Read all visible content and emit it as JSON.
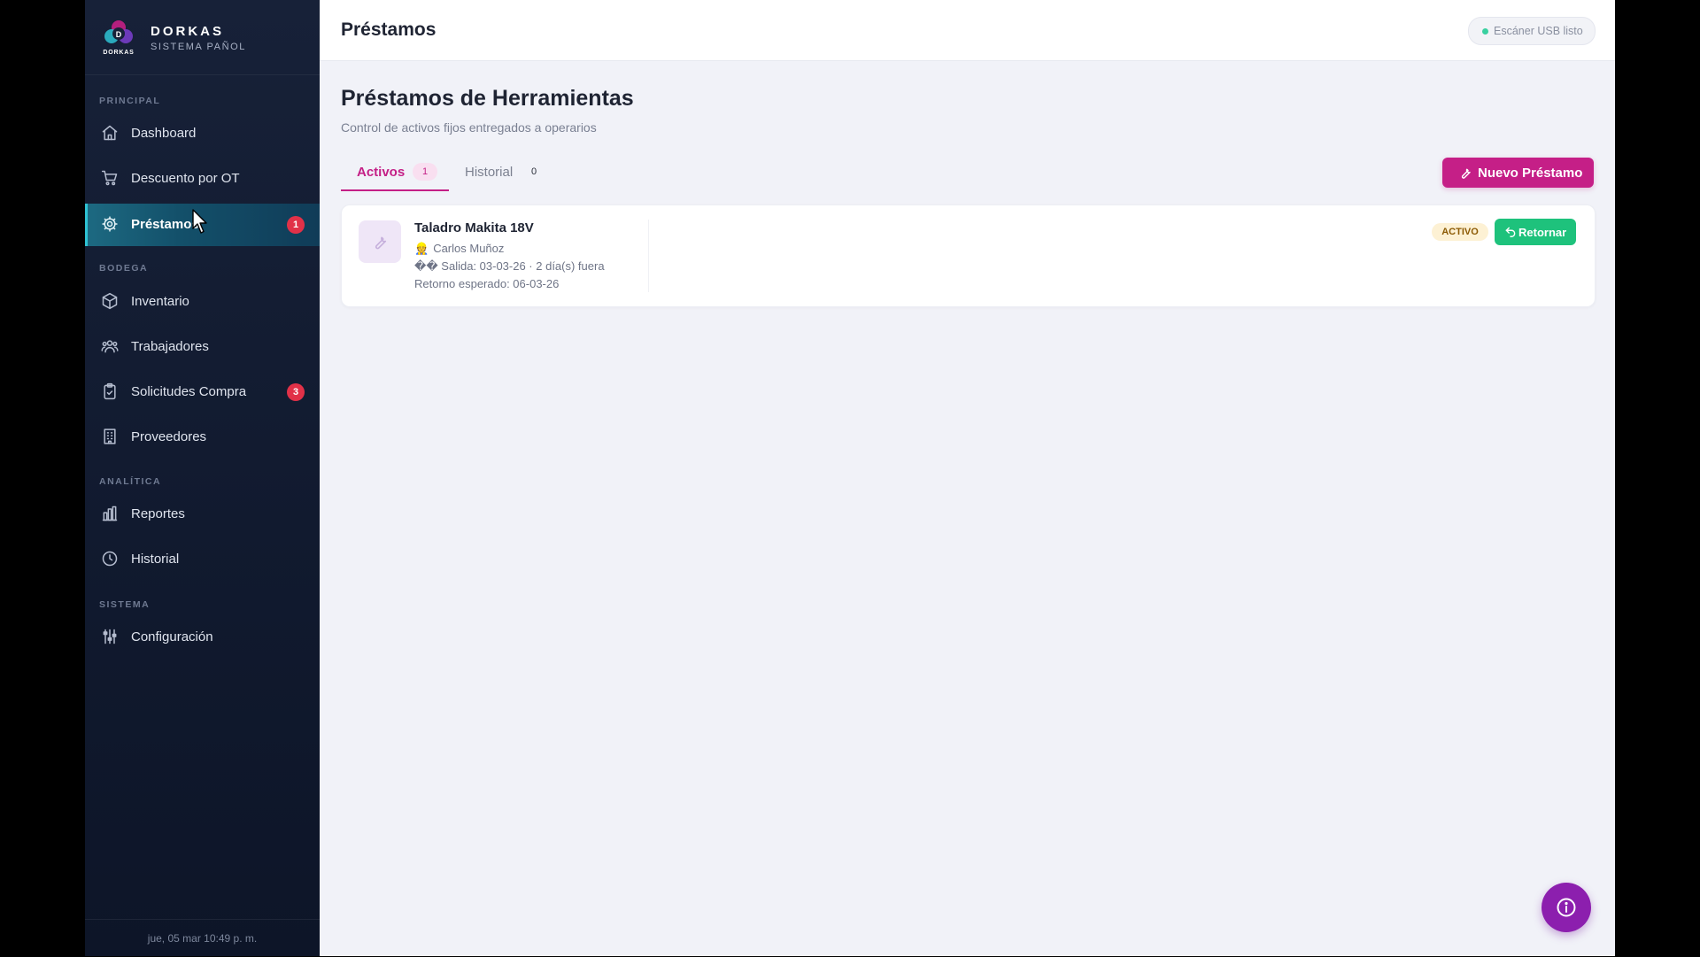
{
  "brand": {
    "logo_text": "DORKAS",
    "logo_letter": "D",
    "title": "DORKAS",
    "subtitle": "SISTEMA PAÑOL"
  },
  "sidebar": {
    "sections": [
      {
        "title": "PRINCIPAL"
      },
      {
        "title": "BODEGA"
      },
      {
        "title": "ANALÍTICA"
      },
      {
        "title": "SISTEMA"
      }
    ],
    "items": [
      {
        "label": "Dashboard",
        "icon": "home-icon"
      },
      {
        "label": "Descuento por OT",
        "icon": "cart-icon"
      },
      {
        "label": "Préstamos",
        "icon": "gear-icon",
        "active": true,
        "badge": "1"
      },
      {
        "label": "Inventario",
        "icon": "box-icon"
      },
      {
        "label": "Trabajadores",
        "icon": "users-icon"
      },
      {
        "label": "Solicitudes Compra",
        "icon": "clipboard-icon",
        "badge": "3"
      },
      {
        "label": "Proveedores",
        "icon": "building-icon"
      },
      {
        "label": "Reportes",
        "icon": "bar-chart-icon"
      },
      {
        "label": "Historial",
        "icon": "clock-icon"
      },
      {
        "label": "Configuración",
        "icon": "sliders-icon"
      }
    ],
    "footer": "jue, 05 mar 10:49 p. m."
  },
  "topbar": {
    "title": "Préstamos",
    "scanner_status": "Escáner USB listo"
  },
  "page": {
    "title": "Préstamos de Herramientas",
    "subtitle": "Control de activos fijos entregados a operarios",
    "new_button": "Nuevo Préstamo"
  },
  "tabs": [
    {
      "label": "Activos",
      "count": "1",
      "active": true
    },
    {
      "label": "Historial",
      "count": "0",
      "active": false
    }
  ],
  "loans": [
    {
      "tool": "Taladro Makita 18V",
      "worker": "Carlos Muñoz",
      "worker_icon": "👷",
      "departure_icon": "��",
      "departure": "Salida: 03-03-26 · 2 día(s) fuera",
      "expected_return": "Retorno esperado: 06-03-26",
      "status": "ACTIVO",
      "return_button": "Retornar"
    }
  ],
  "colors": {
    "accent": "#c51f87",
    "sidebar_bg": "#151e33",
    "active_item": "#1d6a82",
    "success": "#1ec27c",
    "badge": "#e13148",
    "fab": "#8c1fae"
  }
}
